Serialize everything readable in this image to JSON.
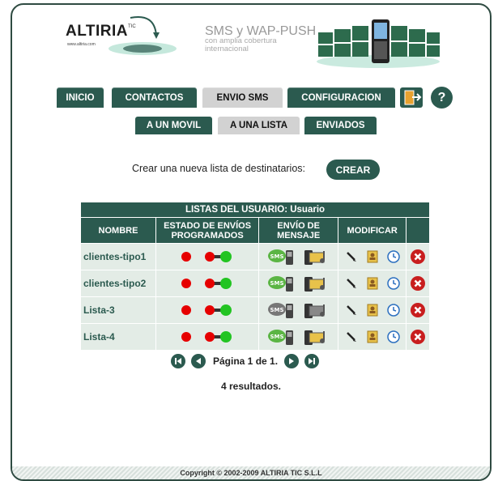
{
  "brand": {
    "logo_text": "ALTIRIA",
    "logo_tic": "TIC",
    "logo_url": "www.altiria.com",
    "hero_title": "SMS y WAP-PUSH",
    "hero_subtitle": "con amplia cobertura internacional"
  },
  "nav": {
    "tabs": [
      "INICIO",
      "CONTACTOS",
      "ENVIO SMS",
      "CONFIGURACION"
    ],
    "active_tab": "ENVIO SMS",
    "help_label": "?",
    "subtabs": [
      "A UN MOVIL",
      "A UNA LISTA",
      "ENVIADOS"
    ],
    "active_subtab": "A UNA LISTA"
  },
  "create": {
    "prompt": "Crear una nueva lista de destinatarios:",
    "button": "CREAR"
  },
  "table": {
    "caption": "LISTAS DEL USUARIO: Usuario",
    "headers": {
      "name": "NOMBRE",
      "status": "ESTADO DE ENVÍOS PROGRAMADOS",
      "send": "ENVÍO DE MENSAJE",
      "modify": "MODIFICAR"
    },
    "rows": [
      {
        "name": "clientes-tipo1"
      },
      {
        "name": "clientes-tipo2"
      },
      {
        "name": "Lista-3"
      },
      {
        "name": "Lista-4"
      }
    ],
    "icons": {
      "status": [
        "red-dot-icon",
        "toggle-red-green-icon"
      ],
      "send": [
        "sms-phone-icon",
        "wap-phone-icon"
      ],
      "modify": [
        "edit-pencil-icon",
        "contacts-book-icon",
        "clock-icon",
        "delete-x-icon"
      ]
    }
  },
  "pager": {
    "text": "Página 1 de 1.",
    "results": "4 resultados."
  },
  "footer": {
    "copyright": "Copyright © 2002-2009 ALTIRIA TIC S.L.L"
  },
  "colors": {
    "primary": "#2b5a4f",
    "row_bg": "#e3ece6",
    "active_tab": "#d2d2d2",
    "status_red": "#e60000",
    "status_green": "#22c422"
  }
}
